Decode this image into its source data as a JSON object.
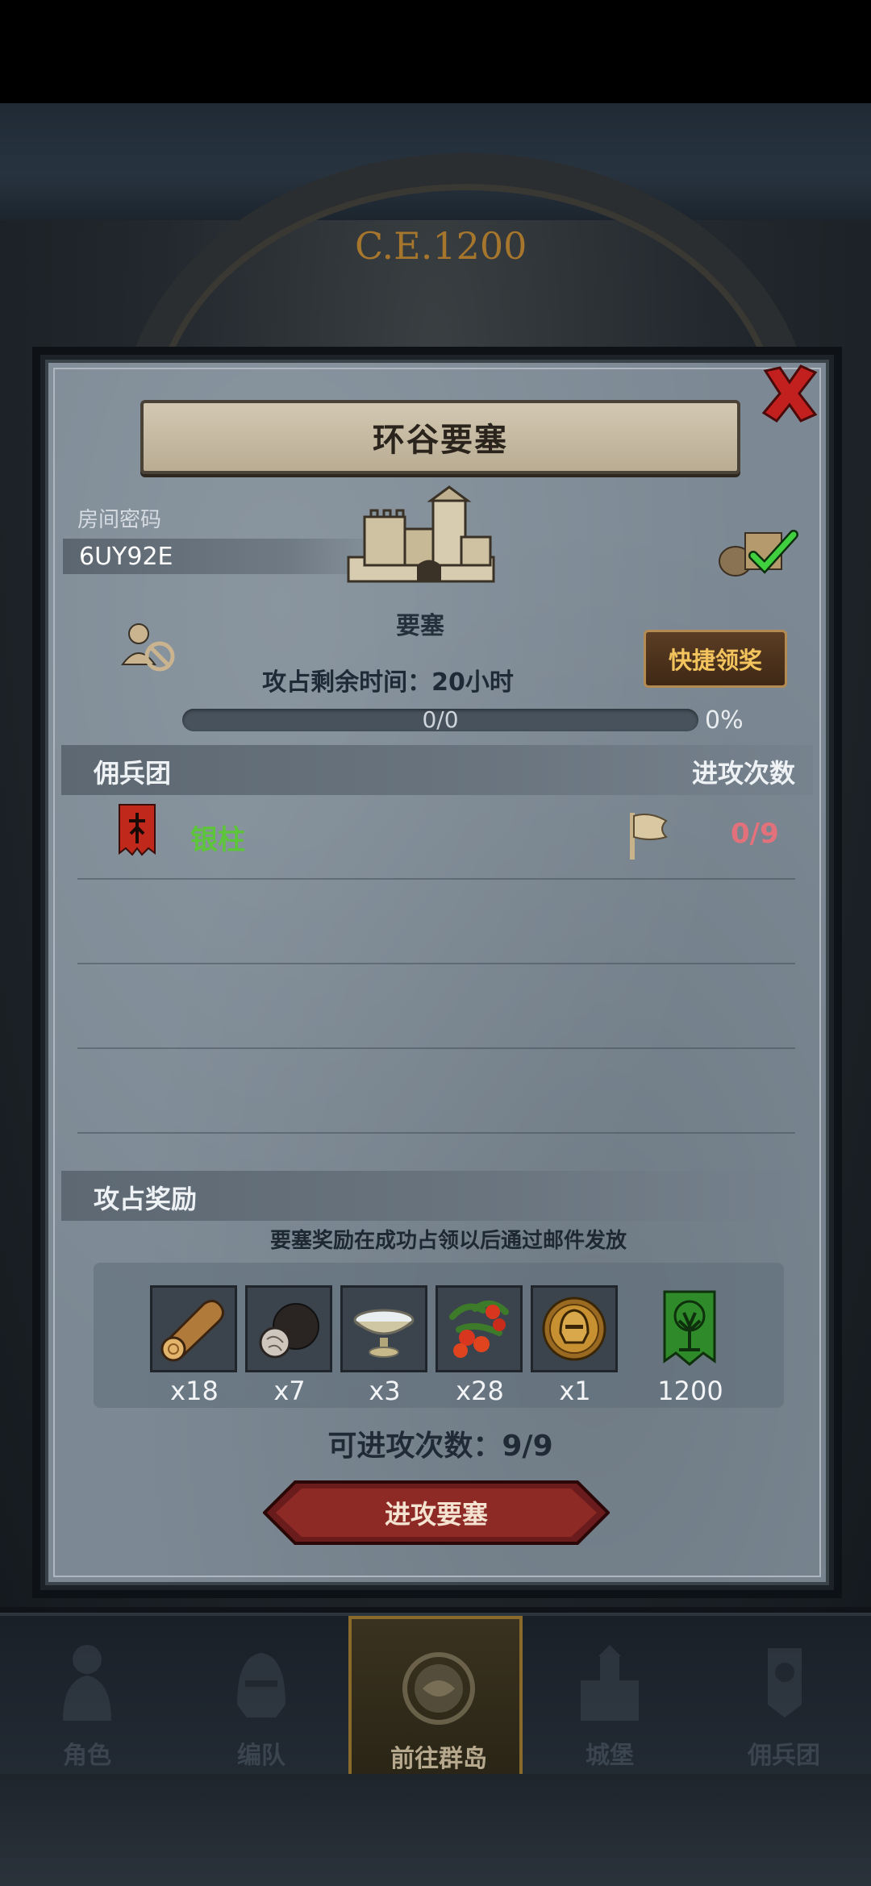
{
  "background": {
    "era_label": "C.E.1200"
  },
  "panel": {
    "title": "环谷要塞",
    "room": {
      "label": "房间密码",
      "code": "6UY92E"
    },
    "fortress": {
      "label": "要塞"
    },
    "quick_claim": "快捷领奖",
    "time_remaining": "攻占剩余时间：20小时",
    "progress": {
      "text": "0/0",
      "percent_label": "0%",
      "fraction": 0
    },
    "roster": {
      "header_left": "佣兵团",
      "header_right": "进攻次数",
      "rows": [
        {
          "name": "银柱",
          "attacks": "0/9"
        }
      ]
    },
    "rewards": {
      "header": "攻占奖励",
      "note": "要塞奖励在成功占领以后通过邮件发放",
      "items": [
        {
          "icon": "wood-log-icon",
          "qty": "x18"
        },
        {
          "icon": "truffle-icon",
          "qty": "x7"
        },
        {
          "icon": "silver-bowl-icon",
          "qty": "x3"
        },
        {
          "icon": "berries-icon",
          "qty": "x28"
        },
        {
          "icon": "helmet-medal-icon",
          "qty": "x1"
        },
        {
          "icon": "tree-banner-icon",
          "qty": "1200"
        }
      ]
    },
    "attacks_available": "可进攻次数：9/9",
    "attack_button": "进攻要塞"
  },
  "nav": [
    {
      "label": "角色",
      "icon": "knight-icon"
    },
    {
      "label": "编队",
      "icon": "helmet-icon"
    },
    {
      "label": "前往群岛",
      "icon": "compass-map-icon",
      "active": true
    },
    {
      "label": "城堡",
      "icon": "castle-icon"
    },
    {
      "label": "佣兵团",
      "icon": "mercenary-icon"
    }
  ]
}
